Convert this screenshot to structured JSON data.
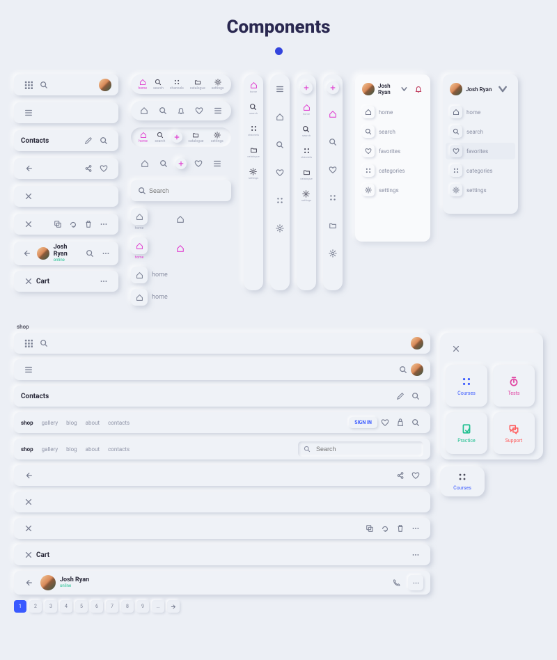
{
  "title": "Components",
  "contacts_label": "Contacts",
  "cart_label": "Cart",
  "search_placeholder": "Search",
  "user": {
    "name": "Josh Ryan",
    "status": "online"
  },
  "nav_items": {
    "home": "home",
    "search": "search",
    "channels": "channels",
    "catalogue": "catalogue",
    "settings": "settings",
    "favorites": "favorites",
    "categories": "categories"
  },
  "shop_label": "shop",
  "shop_nav": [
    "shop",
    "gallery",
    "blog",
    "about",
    "contacts"
  ],
  "signin": "SIGN IN",
  "tiles": {
    "courses": "Courses",
    "tests": "Tests",
    "practice": "Practice",
    "support": "Support"
  },
  "pages": [
    "1",
    "2",
    "3",
    "4",
    "5",
    "6",
    "7",
    "8",
    "9"
  ]
}
